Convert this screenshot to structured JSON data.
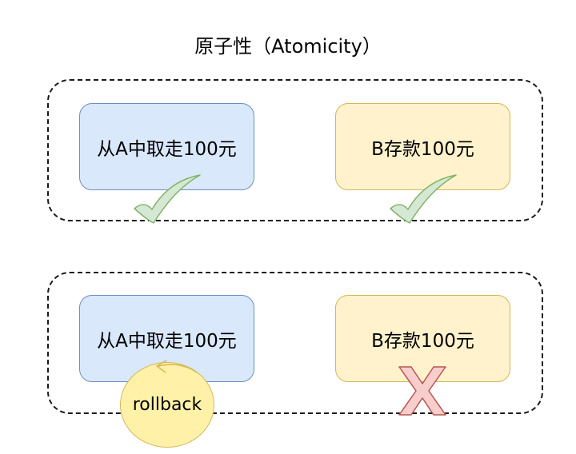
{
  "title": "原子性（Atomicity）",
  "top_group": {
    "left_box": {
      "label": "从A中取走100元",
      "status": "success"
    },
    "right_box": {
      "label": "B存款100元",
      "status": "success"
    }
  },
  "bottom_group": {
    "left_box": {
      "label": "从A中取走100元",
      "status": "rollback"
    },
    "right_box": {
      "label": "B存款100元",
      "status": "failed"
    },
    "rollback_label": "rollback"
  },
  "colors": {
    "blue_fill": "#dae8fc",
    "blue_stroke": "#6c8ebf",
    "yellow_fill": "#fff2cc",
    "yellow_stroke": "#d6b656",
    "check_fill": "#d5e8d4",
    "check_stroke": "#82b366",
    "cross_fill": "#f8cecc",
    "cross_stroke": "#b85450",
    "rollback_fill": "#fff2a8"
  },
  "icons": {
    "success": "checkmark-icon",
    "failed": "cross-icon",
    "rollback": "rollback-arrow-icon"
  }
}
